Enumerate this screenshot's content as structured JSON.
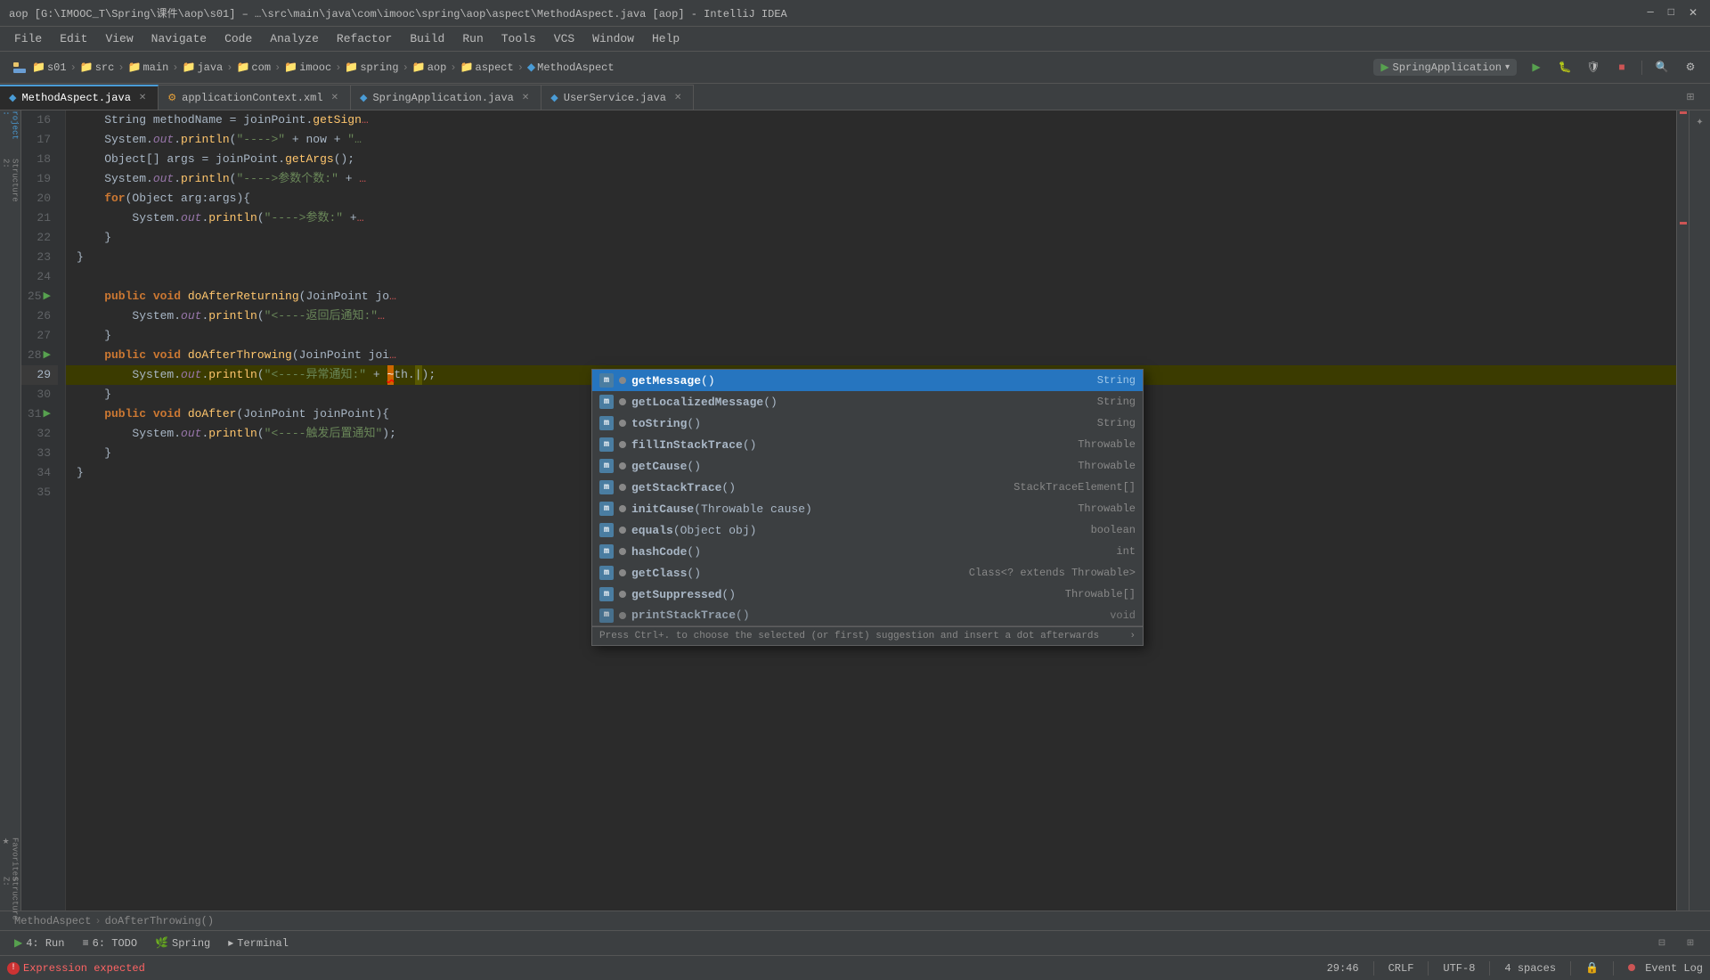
{
  "titleBar": {
    "text": "aop [G:\\IMOOC_T\\Spring\\课件\\aop\\s01] – …\\src\\main\\java\\com\\imooc\\spring\\aop\\aspect\\MethodAspect.java [aop] - IntelliJ IDEA"
  },
  "menuBar": {
    "items": [
      "File",
      "Edit",
      "View",
      "Navigate",
      "Code",
      "Analyze",
      "Refactor",
      "Build",
      "Run",
      "Tools",
      "VCS",
      "Window",
      "Help"
    ]
  },
  "navBar": {
    "project": "s01",
    "breadcrumbs": [
      "src",
      "main",
      "java",
      "com",
      "imooc",
      "spring",
      "aop",
      "aspect",
      "MethodAspect"
    ],
    "runConfig": "SpringApplication"
  },
  "tabs": [
    {
      "label": "MethodAspect.java",
      "icon": "java",
      "active": true
    },
    {
      "label": "applicationContext.xml",
      "icon": "xml",
      "active": false
    },
    {
      "label": "SpringApplication.java",
      "icon": "java",
      "active": false
    },
    {
      "label": "UserService.java",
      "icon": "java",
      "active": false
    }
  ],
  "codeLines": [
    {
      "num": 16,
      "content": "    String methodName = joinPoint.getSign"
    },
    {
      "num": 17,
      "content": "    System.out.println(\"---->\u000e\" + now + \"\u000e\""
    },
    {
      "num": 18,
      "content": "    Object[] args = joinPoint.getArgs();"
    },
    {
      "num": 19,
      "content": "    System.out.println(\"---->参数个数:\" + "
    },
    {
      "num": 20,
      "content": "    for(Object arg:args){"
    },
    {
      "num": 21,
      "content": "        System.out.println(\"---->参数:\" +"
    },
    {
      "num": 22,
      "content": "    }"
    },
    {
      "num": 23,
      "content": "}"
    },
    {
      "num": 24,
      "content": ""
    },
    {
      "num": 25,
      "content": "    public void doAfterReturning(JoinPoint jo"
    },
    {
      "num": 26,
      "content": "        System.out.println(\"<----返回后通知:\""
    },
    {
      "num": 27,
      "content": "    }"
    },
    {
      "num": 28,
      "content": "    public void doAfterThrowing(JoinPoint joi"
    },
    {
      "num": 29,
      "content": "        System.out.println(\"<----异常通知:\" + th.",
      "active": true
    },
    {
      "num": 30,
      "content": "    }"
    },
    {
      "num": 31,
      "content": "    public void doAfter(JoinPoint joinPoint){"
    },
    {
      "num": 32,
      "content": "        System.out.println(\"<----触发后置通知\");"
    },
    {
      "num": 33,
      "content": "    }"
    },
    {
      "num": 34,
      "content": "}"
    },
    {
      "num": 35,
      "content": ""
    }
  ],
  "autocomplete": {
    "items": [
      {
        "name": "getMessage()",
        "type": "String",
        "selected": true,
        "icon": "m"
      },
      {
        "name": "getLocalizedMessage()",
        "type": "String",
        "selected": false,
        "icon": "m"
      },
      {
        "name": "toString()",
        "type": "String",
        "selected": false,
        "icon": "m"
      },
      {
        "name": "fillInStackTrace()",
        "type": "Throwable",
        "selected": false,
        "icon": "m"
      },
      {
        "name": "getCause()",
        "type": "Throwable",
        "selected": false,
        "icon": "m"
      },
      {
        "name": "getStackTrace()",
        "type": "StackTraceElement[]",
        "selected": false,
        "icon": "m"
      },
      {
        "name": "initCause(Throwable cause)",
        "type": "Throwable",
        "selected": false,
        "icon": "m"
      },
      {
        "name": "equals(Object obj)",
        "type": "boolean",
        "selected": false,
        "icon": "m"
      },
      {
        "name": "hashCode()",
        "type": "int",
        "selected": false,
        "icon": "m"
      },
      {
        "name": "getClass()",
        "type": "Class<? extends Throwable>",
        "selected": false,
        "icon": "m"
      },
      {
        "name": "getSuppressed()",
        "type": "Throwable[]",
        "selected": false,
        "icon": "m"
      },
      {
        "name": "printStackTrace()",
        "type": "void",
        "selected": false,
        "icon": "m",
        "partial": true
      }
    ],
    "hint": "Press Ctrl+. to choose the selected (or first) suggestion and insert a dot afterwards"
  },
  "bottomTabs": [
    {
      "label": "4: Run",
      "icon": "▶"
    },
    {
      "label": "6: TODO",
      "icon": "≡"
    },
    {
      "label": "Spring",
      "icon": "🌿"
    },
    {
      "label": "Terminal",
      "icon": ">"
    }
  ],
  "statusBar": {
    "error": "Expression expected",
    "position": "29:46",
    "lineEnding": "CRLF",
    "encoding": "UTF-8",
    "indent": "4 spaces",
    "eventLog": "Event Log"
  },
  "breadcrumbBottom": {
    "class": "MethodAspect",
    "method": "doAfterThrowing()"
  }
}
